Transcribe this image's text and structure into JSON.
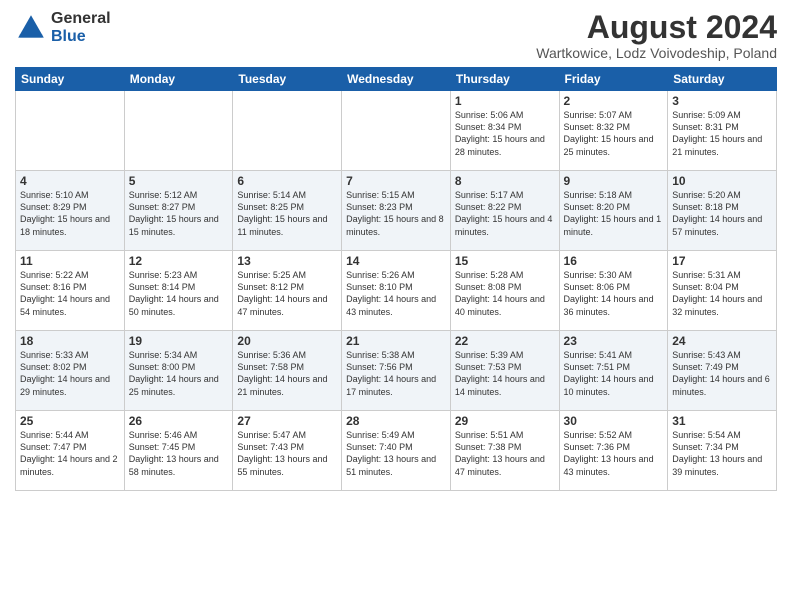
{
  "header": {
    "logo_general": "General",
    "logo_blue": "Blue",
    "title": "August 2024",
    "location": "Wartkowice, Lodz Voivodeship, Poland"
  },
  "weekdays": [
    "Sunday",
    "Monday",
    "Tuesday",
    "Wednesday",
    "Thursday",
    "Friday",
    "Saturday"
  ],
  "weeks": [
    [
      {
        "day": "",
        "info": ""
      },
      {
        "day": "",
        "info": ""
      },
      {
        "day": "",
        "info": ""
      },
      {
        "day": "",
        "info": ""
      },
      {
        "day": "1",
        "info": "Sunrise: 5:06 AM\nSunset: 8:34 PM\nDaylight: 15 hours\nand 28 minutes."
      },
      {
        "day": "2",
        "info": "Sunrise: 5:07 AM\nSunset: 8:32 PM\nDaylight: 15 hours\nand 25 minutes."
      },
      {
        "day": "3",
        "info": "Sunrise: 5:09 AM\nSunset: 8:31 PM\nDaylight: 15 hours\nand 21 minutes."
      }
    ],
    [
      {
        "day": "4",
        "info": "Sunrise: 5:10 AM\nSunset: 8:29 PM\nDaylight: 15 hours\nand 18 minutes."
      },
      {
        "day": "5",
        "info": "Sunrise: 5:12 AM\nSunset: 8:27 PM\nDaylight: 15 hours\nand 15 minutes."
      },
      {
        "day": "6",
        "info": "Sunrise: 5:14 AM\nSunset: 8:25 PM\nDaylight: 15 hours\nand 11 minutes."
      },
      {
        "day": "7",
        "info": "Sunrise: 5:15 AM\nSunset: 8:23 PM\nDaylight: 15 hours\nand 8 minutes."
      },
      {
        "day": "8",
        "info": "Sunrise: 5:17 AM\nSunset: 8:22 PM\nDaylight: 15 hours\nand 4 minutes."
      },
      {
        "day": "9",
        "info": "Sunrise: 5:18 AM\nSunset: 8:20 PM\nDaylight: 15 hours\nand 1 minute."
      },
      {
        "day": "10",
        "info": "Sunrise: 5:20 AM\nSunset: 8:18 PM\nDaylight: 14 hours\nand 57 minutes."
      }
    ],
    [
      {
        "day": "11",
        "info": "Sunrise: 5:22 AM\nSunset: 8:16 PM\nDaylight: 14 hours\nand 54 minutes."
      },
      {
        "day": "12",
        "info": "Sunrise: 5:23 AM\nSunset: 8:14 PM\nDaylight: 14 hours\nand 50 minutes."
      },
      {
        "day": "13",
        "info": "Sunrise: 5:25 AM\nSunset: 8:12 PM\nDaylight: 14 hours\nand 47 minutes."
      },
      {
        "day": "14",
        "info": "Sunrise: 5:26 AM\nSunset: 8:10 PM\nDaylight: 14 hours\nand 43 minutes."
      },
      {
        "day": "15",
        "info": "Sunrise: 5:28 AM\nSunset: 8:08 PM\nDaylight: 14 hours\nand 40 minutes."
      },
      {
        "day": "16",
        "info": "Sunrise: 5:30 AM\nSunset: 8:06 PM\nDaylight: 14 hours\nand 36 minutes."
      },
      {
        "day": "17",
        "info": "Sunrise: 5:31 AM\nSunset: 8:04 PM\nDaylight: 14 hours\nand 32 minutes."
      }
    ],
    [
      {
        "day": "18",
        "info": "Sunrise: 5:33 AM\nSunset: 8:02 PM\nDaylight: 14 hours\nand 29 minutes."
      },
      {
        "day": "19",
        "info": "Sunrise: 5:34 AM\nSunset: 8:00 PM\nDaylight: 14 hours\nand 25 minutes."
      },
      {
        "day": "20",
        "info": "Sunrise: 5:36 AM\nSunset: 7:58 PM\nDaylight: 14 hours\nand 21 minutes."
      },
      {
        "day": "21",
        "info": "Sunrise: 5:38 AM\nSunset: 7:56 PM\nDaylight: 14 hours\nand 17 minutes."
      },
      {
        "day": "22",
        "info": "Sunrise: 5:39 AM\nSunset: 7:53 PM\nDaylight: 14 hours\nand 14 minutes."
      },
      {
        "day": "23",
        "info": "Sunrise: 5:41 AM\nSunset: 7:51 PM\nDaylight: 14 hours\nand 10 minutes."
      },
      {
        "day": "24",
        "info": "Sunrise: 5:43 AM\nSunset: 7:49 PM\nDaylight: 14 hours\nand 6 minutes."
      }
    ],
    [
      {
        "day": "25",
        "info": "Sunrise: 5:44 AM\nSunset: 7:47 PM\nDaylight: 14 hours\nand 2 minutes."
      },
      {
        "day": "26",
        "info": "Sunrise: 5:46 AM\nSunset: 7:45 PM\nDaylight: 13 hours\nand 58 minutes."
      },
      {
        "day": "27",
        "info": "Sunrise: 5:47 AM\nSunset: 7:43 PM\nDaylight: 13 hours\nand 55 minutes."
      },
      {
        "day": "28",
        "info": "Sunrise: 5:49 AM\nSunset: 7:40 PM\nDaylight: 13 hours\nand 51 minutes."
      },
      {
        "day": "29",
        "info": "Sunrise: 5:51 AM\nSunset: 7:38 PM\nDaylight: 13 hours\nand 47 minutes."
      },
      {
        "day": "30",
        "info": "Sunrise: 5:52 AM\nSunset: 7:36 PM\nDaylight: 13 hours\nand 43 minutes."
      },
      {
        "day": "31",
        "info": "Sunrise: 5:54 AM\nSunset: 7:34 PM\nDaylight: 13 hours\nand 39 minutes."
      }
    ]
  ]
}
